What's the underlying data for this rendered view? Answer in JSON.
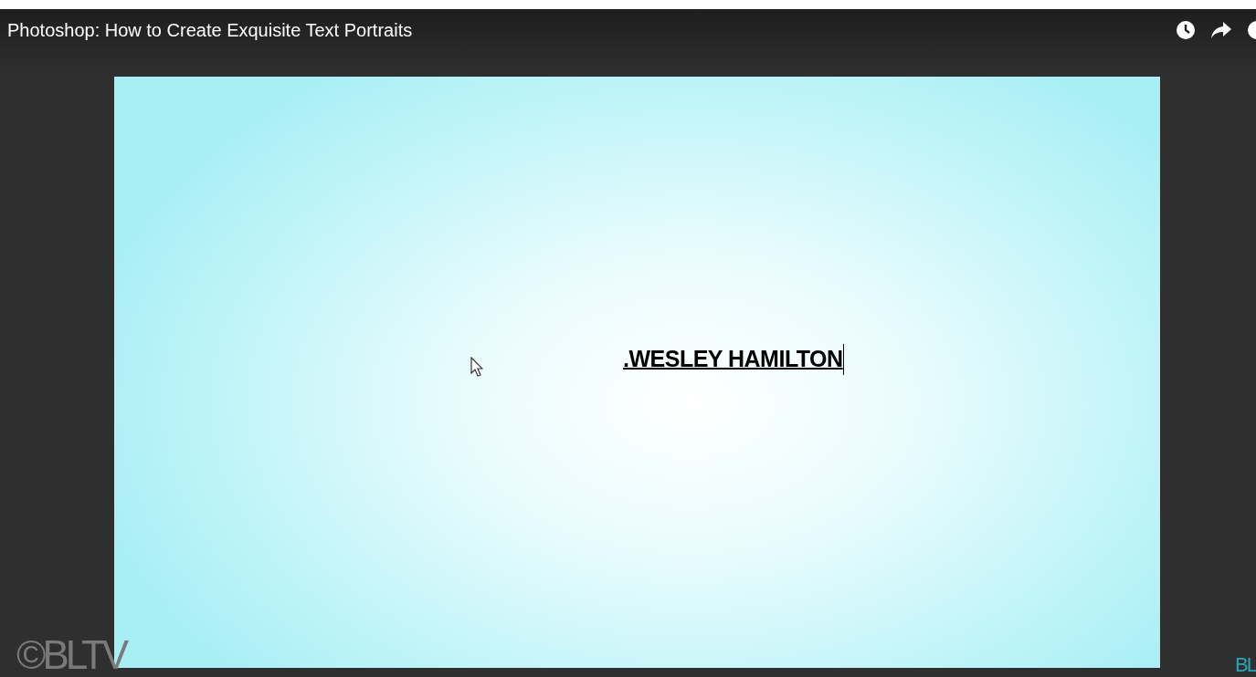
{
  "video": {
    "title": "Photoshop: How to Create Exquisite Text Portraits"
  },
  "canvas": {
    "text": ".WESLEY HAMILTON"
  },
  "branding": [
    {
      "text": "©BLTV",
      "kind": "left"
    },
    {
      "text": "BL",
      "kind": "right"
    }
  ]
}
